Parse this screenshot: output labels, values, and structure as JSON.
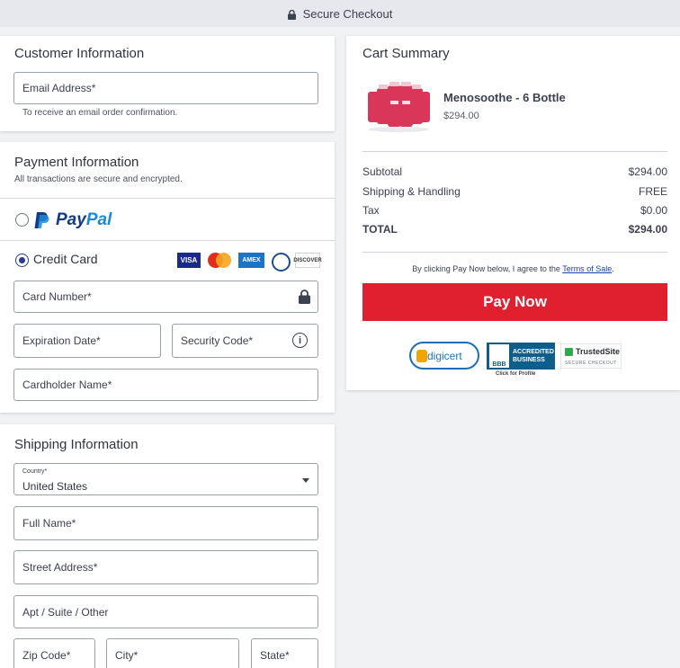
{
  "topbar": {
    "title": "Secure Checkout"
  },
  "customer": {
    "heading": "Customer Information",
    "email_label": "Email Address*",
    "email_hint": "To receive an email order confirmation."
  },
  "payment": {
    "heading": "Payment Information",
    "subtitle": "All transactions are secure and encrypted.",
    "paypal": {
      "pay": "Pay",
      "pal": "Pal",
      "selected": false
    },
    "credit_card": {
      "label": "Credit Card",
      "selected": true
    },
    "card_logos": {
      "visa": "VISA",
      "amex": "AMEX",
      "discover": "DISCOVER"
    },
    "card_number_label": "Card Number*",
    "expiration_label": "Expiration Date*",
    "security_label": "Security Code*",
    "info_glyph": "i",
    "cardholder_label": "Cardholder Name*"
  },
  "shipping": {
    "heading": "Shipping Information",
    "country_label": "Country*",
    "country_value": "United States",
    "full_name_label": "Full Name*",
    "street_label": "Street Address*",
    "apt_label": "Apt / Suite / Other",
    "zip_label": "Zip Code*",
    "city_label": "City*",
    "state_label": "State*"
  },
  "cart": {
    "heading": "Cart Summary",
    "product": {
      "name": "Menosoothe - 6 Bottle",
      "price": "$294.00"
    },
    "rows": [
      {
        "label": "Subtotal",
        "value": "$294.00"
      },
      {
        "label": "Shipping & Handling",
        "value": "FREE"
      },
      {
        "label": "Tax",
        "value": "$0.00"
      },
      {
        "label": "TOTAL",
        "value": "$294.00"
      }
    ],
    "agree_text": "By clicking Pay Now below, I agree to the ",
    "terms_link": "Terms of Sale",
    "agree_end": ".",
    "pay_button": "Pay Now",
    "badges": {
      "digicert": "digicert",
      "bbb_line1": "ACCREDITED",
      "bbb_line2": "BUSINESS",
      "bbb_seal": "BBB",
      "bbb_sub": "Click for Profile",
      "trusted_title": "TrustedSite",
      "trusted_sub": "SECURE CHECKOUT"
    }
  },
  "colors": {
    "accent_red": "#e0202f",
    "paypal_dark": "#123a86",
    "paypal_light": "#1b8ad6",
    "radio_selected": "#2a3a8c"
  },
  "icons": [
    "lock-icon",
    "paypal-icon",
    "visa-icon",
    "mastercard-icon",
    "amex-icon",
    "diners-icon",
    "discover-icon",
    "info-icon",
    "chevron-down-icon",
    "product-bottles-image"
  ]
}
